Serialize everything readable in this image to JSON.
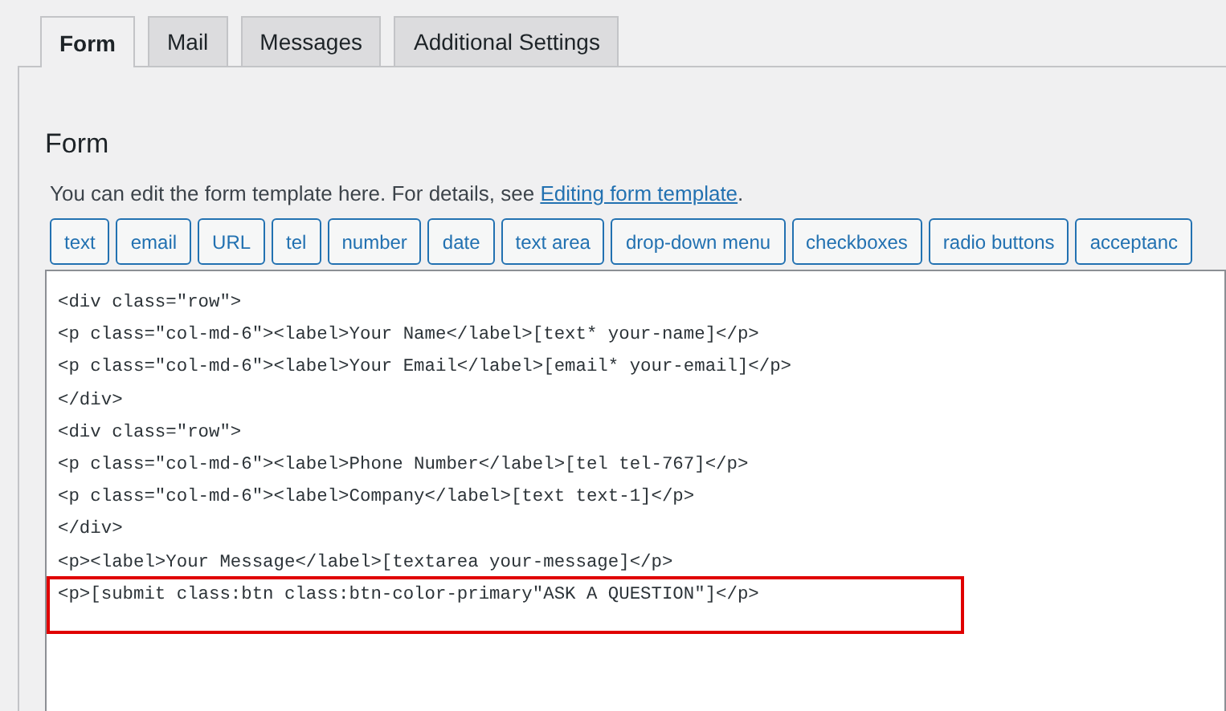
{
  "tabs": [
    {
      "label": "Form",
      "selected": true
    },
    {
      "label": "Mail",
      "selected": false
    },
    {
      "label": "Messages",
      "selected": false
    },
    {
      "label": "Additional Settings",
      "selected": false
    }
  ],
  "panel": {
    "heading": "Form",
    "description": "You can edit the form template here. For details, see ",
    "link": "Editing form template",
    "after_link": "."
  },
  "tag_buttons": [
    "text",
    "email",
    "URL",
    "tel",
    "number",
    "date",
    "text area",
    "drop-down menu",
    "checkboxes",
    "radio buttons",
    "acceptanc"
  ],
  "editor": {
    "lines": [
      {
        "text": "<div class=\"row\">",
        "highlighted": false
      },
      {
        "text": "<p class=\"col-md-6\"><label>Your Name</label>[text* your-name]</p>",
        "highlighted": false
      },
      {
        "text": "<p class=\"col-md-6\"><label>Your Email</label>[email* your-email]</p>",
        "highlighted": false
      },
      {
        "text": "</div>",
        "highlighted": false
      },
      {
        "text": "<div class=\"row\">",
        "highlighted": false
      },
      {
        "text": "<p class=\"col-md-6\"><label>Phone Number</label>[tel tel-767]</p>",
        "highlighted": false
      },
      {
        "text": "<p class=\"col-md-6\"><label>Company</label>[text text-1]</p>",
        "highlighted": false
      },
      {
        "text": "</div>",
        "highlighted": false
      },
      {
        "text": "<p><label>Your Message</label>[textarea your-message]</p>",
        "highlighted": false
      },
      {
        "text": "<p>[submit class:btn class:btn-color-primary\"ASK A QUESTION\"]</p>",
        "highlighted": true
      }
    ]
  }
}
